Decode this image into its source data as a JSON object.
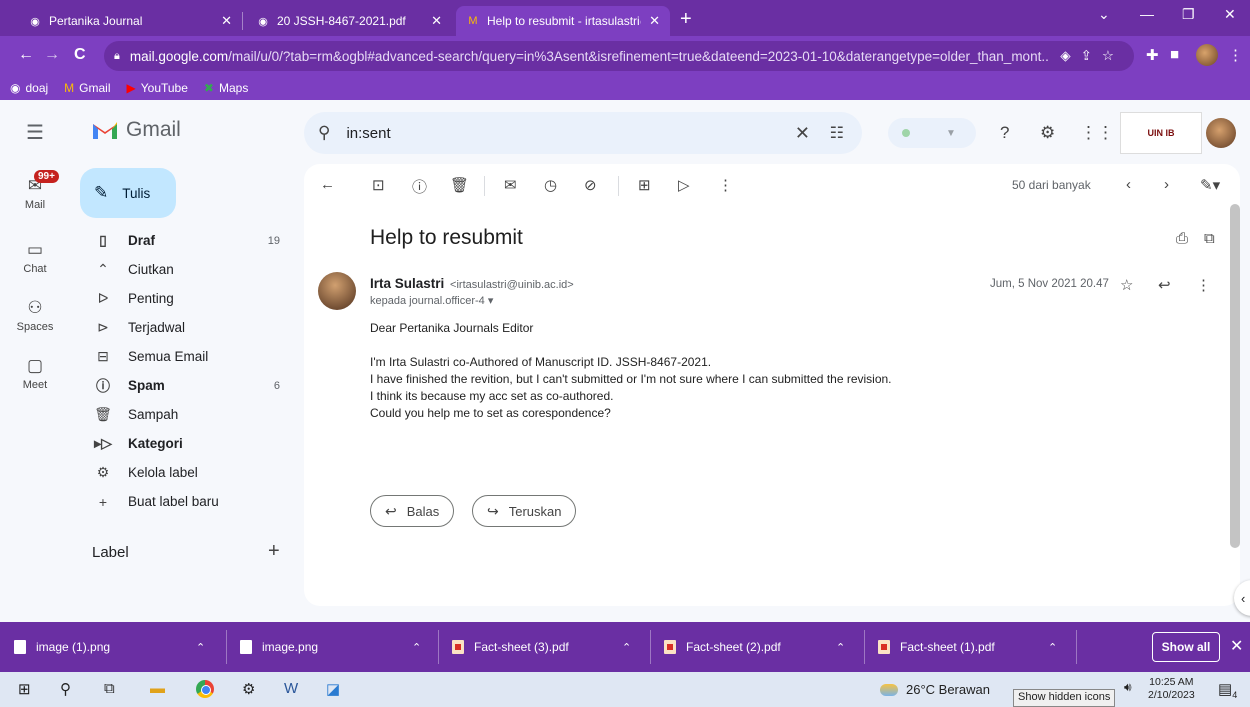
{
  "browser": {
    "tabs": [
      {
        "title": "Pertanika Journal"
      },
      {
        "title": "20 JSSH-8467-2021.pdf"
      },
      {
        "title": "Help to resubmit - irtasulastri@u"
      }
    ],
    "address": {
      "host": "mail.google.com",
      "path": "/mail/u/0/?tab=rm&ogbl#advanced-search/query=in%3Asent&isrefinement=true&dateend=2023-01-10&daterangetype=older_than_mont..."
    },
    "bookmarks": [
      {
        "label": "doaj",
        "icon": "globe-icon"
      },
      {
        "label": "Gmail",
        "icon": "gmail-icon"
      },
      {
        "label": "YouTube",
        "icon": "youtube-icon"
      },
      {
        "label": "Maps",
        "icon": "maps-icon"
      }
    ]
  },
  "gmail": {
    "app_name": "Gmail",
    "search_query": "in:sent",
    "rail": [
      {
        "label": "Mail",
        "badge": "99+"
      },
      {
        "label": "Chat"
      },
      {
        "label": "Spaces"
      },
      {
        "label": "Meet"
      }
    ],
    "compose_label": "Tulis",
    "folders": [
      {
        "label": "Draf",
        "count": "19",
        "bold": true,
        "icon": "draft-icon"
      },
      {
        "label": "Ciutkan",
        "icon": "chevron-up-icon"
      },
      {
        "label": "Penting",
        "icon": "important-icon"
      },
      {
        "label": "Terjadwal",
        "icon": "scheduled-icon"
      },
      {
        "label": "Semua Email",
        "icon": "all-mail-icon"
      },
      {
        "label": "Spam",
        "count": "6",
        "bold": true,
        "icon": "spam-icon"
      },
      {
        "label": "Sampah",
        "icon": "trash-icon"
      },
      {
        "label": "Kategori",
        "bold": true,
        "icon": "label-icon"
      },
      {
        "label": "Kelola label",
        "icon": "gear-icon"
      },
      {
        "label": "Buat label baru",
        "icon": "plus-icon"
      }
    ],
    "labels_heading": "Label",
    "message": {
      "pager_text": "50 dari banyak",
      "subject": "Help to resubmit",
      "sender_name": "Irta Sulastri",
      "sender_email": "<irtasulastri@uinib.ac.id>",
      "recipient": "kepada journal.officer-4 ▾",
      "date": "Jum, 5 Nov 2021 20.47",
      "body": [
        "Dear Pertanika Journals Editor",
        "",
        "I'm Irta Sulastri co-Authored of Manuscript ID. JSSH-8467-2021.",
        "I have finished the revition, but I can't submitted or I'm not sure where I can submitted the revision.",
        "I think its because my acc set as co-authored.",
        "Could you help me to set as corespondence?"
      ],
      "reply_label": "Balas",
      "forward_label": "Teruskan"
    }
  },
  "downloads": {
    "items": [
      {
        "name": "image (1).png",
        "type": "image"
      },
      {
        "name": "image.png",
        "type": "image"
      },
      {
        "name": "Fact-sheet (3).pdf",
        "type": "pdf"
      },
      {
        "name": "Fact-sheet (2).pdf",
        "type": "pdf"
      },
      {
        "name": "Fact-sheet (1).pdf",
        "type": "pdf"
      }
    ],
    "show_all": "Show all"
  },
  "taskbar": {
    "weather": "26°C Berawan",
    "tooltip": "Show hidden icons",
    "time": "10:25 AM",
    "date": "2/10/2023",
    "notifications": "4"
  },
  "colors": {
    "browser_frame": "#6a2fa3",
    "browser_toolbar": "#7d3fc1",
    "compose_bg": "#c2e7ff",
    "badge": "#c5221f"
  }
}
